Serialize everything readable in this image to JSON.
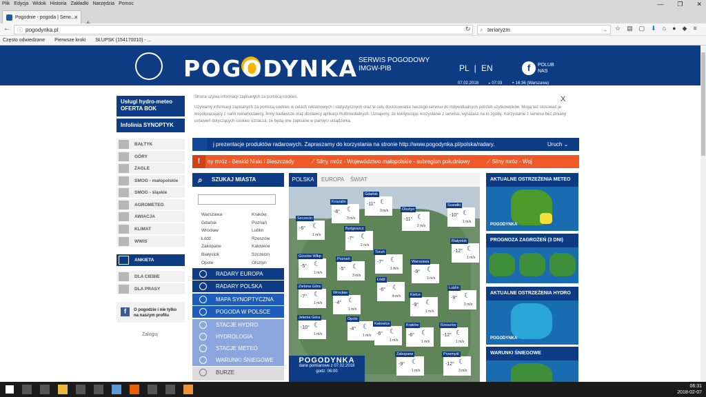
{
  "browser": {
    "menu": [
      "Plik",
      "Edycja",
      "Widok",
      "Historia",
      "Zakładki",
      "Narzędzia",
      "Pomoc"
    ],
    "tab_title": "Pogodnie - pogoda | Serw...",
    "new_tab": "+",
    "url": "pogodynka.pl",
    "search": "terioryzm",
    "bookmarks": [
      "Często odwiedzane",
      "Pierwsze kroki",
      "SŁUPSK (154170010) - ..."
    ]
  },
  "header": {
    "brand": "POGODYNKA",
    "subtitle1": "SERWIS POGODOWY",
    "subtitle2": "IMGW-PIB",
    "lang_pl": "PL",
    "lang_sep": "|",
    "lang_en": "EN",
    "fb_like_line1": "POLUB",
    "fb_like_line2": "NAS",
    "date": "07.02.2018",
    "sunrise": "07:03",
    "sunset": "16:36",
    "sunset_zone": "(Warszawa)"
  },
  "sidebar": {
    "btn1_line1": "Usługi hydro-meteo",
    "btn1_line2": "OFERTA BOK",
    "btn2": "Infolinia SYNOPTYK",
    "items": [
      "BAŁTYK",
      "GÓRY",
      "ŻAGLE",
      "SMOG - małopolskie",
      "SMOG - śląskie",
      "AGROMETEO",
      "AWIACJA",
      "KLIMAT",
      "WWIS"
    ],
    "ankieta": "ANKIETA",
    "items2": [
      "DLA CIEBIE",
      "DLA PRASY"
    ],
    "fb_text": "O pogodzie i nie tylko na naszym profilu",
    "login": "Zaloguj"
  },
  "cookie": {
    "title": "Strona używa informacji zapisanych za pomocą cookies.",
    "text": "Używamy informacji zapisanych za pomocą cookies w celach reklamowych i statystycznych oraz w celu dostosowania naszego serwisu do indywidualnych potrzeb użytkowników. Mogą też stosować je współpracujący z nami reklamodawcy, firmy badawcze oraz dostawcy aplikacji multimedialnych. Uznajemy, że kontynuując korzystanie z serwisu, wyrażasz na to zgodę. Korzystanie z serwisu bez zmiany ustawień dotyczących cookies oznacza, że będą one zapisane w pamięci urządzenia.",
    "close": "X"
  },
  "ticker": {
    "info": "j prezentacje produktów radarowych. Zapraszamy do korzystania na stronie http://www.pogodynka.pl/polska/radary.",
    "info_end": "Uruch",
    "warn": "ny mróz - Beskid Niski i Bieszczady",
    "warn2": "Silny mróz - Województwo małopolskie - subregion południowy",
    "warn3": "Silny mróz - Woj"
  },
  "search": {
    "title": "SZUKAJ MIASTA",
    "cities": [
      "Warszawa",
      "Kraków",
      "Gdańsk",
      "Poznań",
      "Wrocław",
      "Lublin",
      "Łódź",
      "Rzeszów",
      "Zakopane",
      "Katowice",
      "Białystok",
      "Szczecin",
      "Opole",
      "Olsztyn"
    ]
  },
  "links": [
    "RADARY EUROPA",
    "RADARY POLSKA",
    "MAPA SYNOPTYCZNA",
    "POGODA W POLSCE",
    "STACJE HYDRO",
    "HYDROLOGIA",
    "STACJE METEO",
    "WARUNKI ŚNIEGOWE",
    "BURZE"
  ],
  "map": {
    "tabs": [
      "POLSKA",
      "EUROPA",
      "ŚWIAT"
    ],
    "footer_brand": "POGODYNKA",
    "footer_date": "dane pomiarowe z 07.02.2018",
    "footer_time": "godz: 06:00",
    "cities": [
      {
        "name": "Gdańsk",
        "temp": "-11°",
        "wind": "3"
      },
      {
        "name": "Szczecin",
        "temp": "-6°",
        "wind": "1"
      },
      {
        "name": "Koszalin",
        "temp": "-8°",
        "wind": "3"
      },
      {
        "name": "Olsztyn",
        "temp": "-11°",
        "wind": "2"
      },
      {
        "name": "Suwałki",
        "temp": "-10°",
        "wind": "1"
      },
      {
        "name": "Bydgoszcz",
        "temp": "-7°",
        "wind": "2"
      },
      {
        "name": "Białystok",
        "temp": "-12°",
        "wind": "1"
      },
      {
        "name": "Gorzów Wlkp",
        "temp": "-5°",
        "wind": "1"
      },
      {
        "name": "Poznań",
        "temp": "-5°",
        "wind": "3"
      },
      {
        "name": "Toruń",
        "temp": "-7°",
        "wind": "1"
      },
      {
        "name": "Warszawa",
        "temp": "-9°",
        "wind": "3"
      },
      {
        "name": "Zielona Góra",
        "temp": "-7°",
        "wind": "1"
      },
      {
        "name": "Łódź",
        "temp": "-6°",
        "wind": "4"
      },
      {
        "name": "Wrocław",
        "temp": "-4°",
        "wind": "1"
      },
      {
        "name": "Kielce",
        "temp": "-9°",
        "wind": "1"
      },
      {
        "name": "Lublin",
        "temp": "-9°",
        "wind": "2"
      },
      {
        "name": "Jelenia Góra",
        "temp": "-10°",
        "wind": "1"
      },
      {
        "name": "Opole",
        "temp": "-4°",
        "wind": "1"
      },
      {
        "name": "Katowice",
        "temp": "-6°",
        "wind": "1"
      },
      {
        "name": "Kraków",
        "temp": "-6°",
        "wind": "1"
      },
      {
        "name": "Rzeszów",
        "temp": "-12°",
        "wind": "1"
      },
      {
        "name": "Zakopane",
        "temp": "-9°",
        "wind": "1"
      },
      {
        "name": "Przemyśl",
        "temp": "-12°",
        "wind": "3"
      }
    ]
  },
  "right": {
    "h1": "AKTUALNE OSTRZEŻENIA METEO",
    "h2": "PROGNOZA ZAGROŻEŃ (3 DNI)",
    "h3": "AKTUALNE OSTRZEŻENIA HYDRO",
    "h4": "WARUNKI ŚNIEGOWE",
    "brand": "POGODYNKA"
  },
  "taskbar": {
    "time": "06:31",
    "date": "2018-02-07"
  }
}
